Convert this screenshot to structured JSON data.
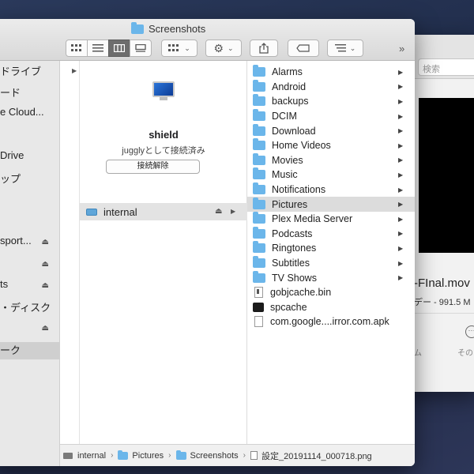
{
  "back_window": {
    "search_placeholder": "検索",
    "file_name": "-FInal.mov",
    "file_meta": "デー - 991.5 M",
    "label_left": "ム",
    "label_right": "その"
  },
  "finder": {
    "title": "Screenshots",
    "sidebar": [
      {
        "label": "ドライブ",
        "eject": false,
        "selected": false
      },
      {
        "label": "ード",
        "eject": false,
        "selected": false
      },
      {
        "label": "e Cloud...",
        "eject": false,
        "selected": false
      },
      {
        "label": "",
        "eject": false,
        "selected": false
      },
      {
        "label": "Drive",
        "eject": false,
        "selected": false
      },
      {
        "label": "ップ",
        "eject": false,
        "selected": false
      },
      {
        "label": "",
        "eject": false,
        "selected": false
      },
      {
        "label": "",
        "eject": false,
        "selected": false
      },
      {
        "label": "sport...",
        "eject": true,
        "selected": false
      },
      {
        "label": "",
        "eject": true,
        "selected": false
      },
      {
        "label": "ts",
        "eject": true,
        "selected": false
      },
      {
        "label": "・ディスク",
        "eject": false,
        "selected": false
      },
      {
        "label": "",
        "eject": true,
        "selected": false
      },
      {
        "label": "ーク",
        "eject": false,
        "selected": true
      }
    ],
    "device": {
      "name": "shield",
      "status": "jugglyとして接続済み",
      "disconnect_label": "接続解除",
      "volume": "internal"
    },
    "items": [
      {
        "name": "Alarms",
        "type": "folder"
      },
      {
        "name": "Android",
        "type": "folder"
      },
      {
        "name": "backups",
        "type": "folder"
      },
      {
        "name": "DCIM",
        "type": "folder"
      },
      {
        "name": "Download",
        "type": "folder"
      },
      {
        "name": "Home Videos",
        "type": "folder"
      },
      {
        "name": "Movies",
        "type": "folder"
      },
      {
        "name": "Music",
        "type": "folder"
      },
      {
        "name": "Notifications",
        "type": "folder"
      },
      {
        "name": "Pictures",
        "type": "folder",
        "selected": true
      },
      {
        "name": "Plex Media Server",
        "type": "folder"
      },
      {
        "name": "Podcasts",
        "type": "folder"
      },
      {
        "name": "Ringtones",
        "type": "folder"
      },
      {
        "name": "Subtitles",
        "type": "folder"
      },
      {
        "name": "TV Shows",
        "type": "folder"
      },
      {
        "name": "gobjcache.bin",
        "type": "exec"
      },
      {
        "name": "spcache",
        "type": "terminal"
      },
      {
        "name": "com.google....irror.com.apk",
        "type": "doc"
      }
    ],
    "path": {
      "p0": "internal",
      "p1": "Pictures",
      "p2": "Screenshots",
      "p3": "設定_20191114_000718.png"
    }
  }
}
